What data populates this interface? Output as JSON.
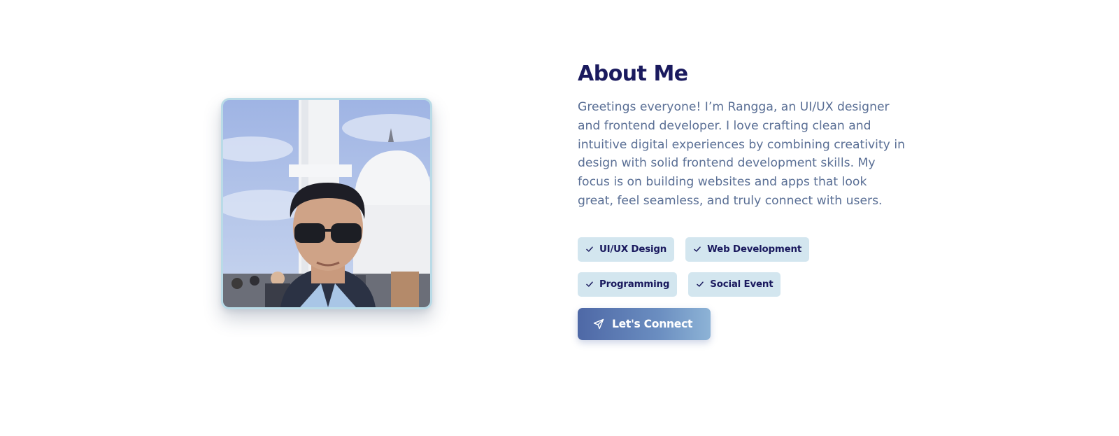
{
  "about": {
    "title": "About Me",
    "bio": "Greetings everyone! I’m Rangga, an UI/UX designer and frontend developer. I love crafting clean and intuitive digital experiences by combining creativity in design with solid frontend development skills. My focus is on building websites and apps that look great, feel seamless, and truly connect with users.",
    "skills": [
      "UI/UX Design",
      "Web Development",
      "Programming",
      "Social Event"
    ],
    "cta_label": "Let's Connect"
  },
  "icons": {
    "skill_check": "check-icon",
    "cta": "send-icon"
  },
  "colors": {
    "title": "#1a1a5e",
    "body_text": "#5a6f95",
    "tag_bg": "#d3e6ef",
    "photo_border": "#b9dbe7",
    "button_gradient_start": "#4e68a6",
    "button_gradient_end": "#8db3d6"
  }
}
